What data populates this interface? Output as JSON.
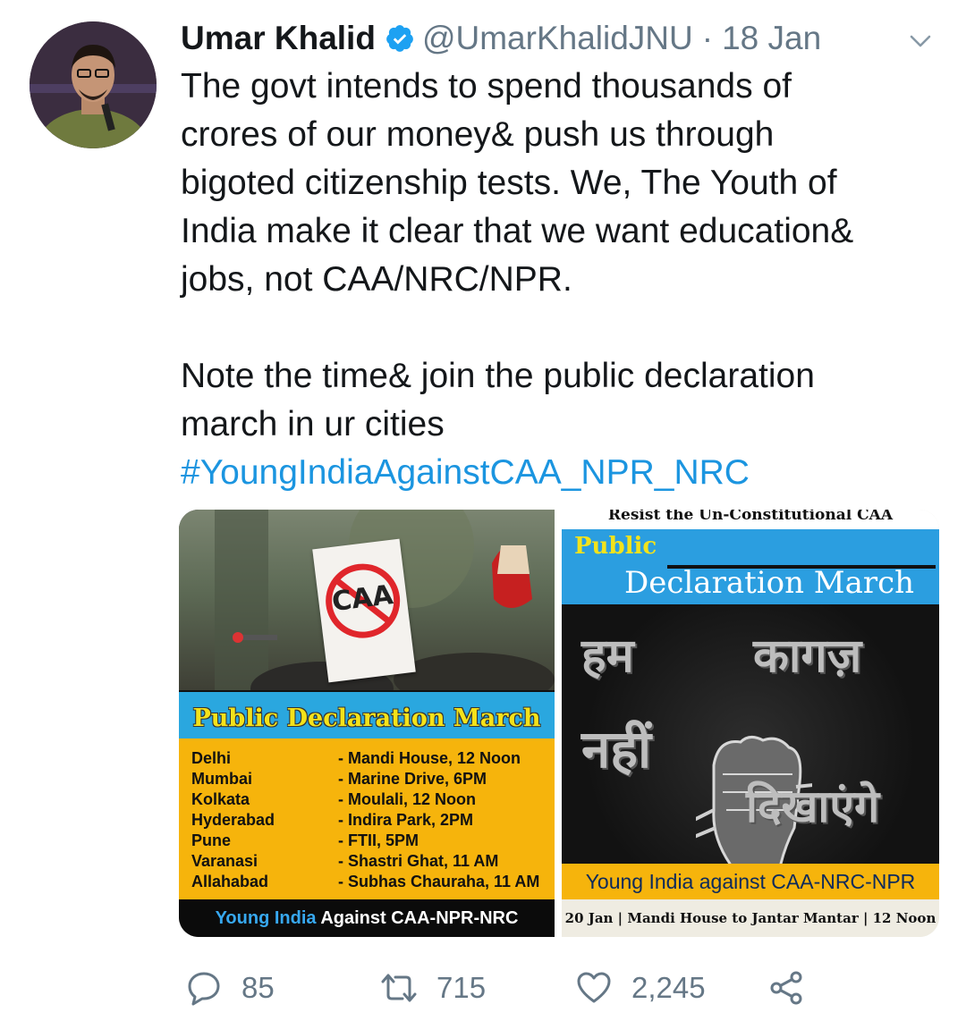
{
  "tweet": {
    "author_name": "Umar Khalid",
    "handle": "@UmarKhalidJNU",
    "separator": "·",
    "date": "18 Jan",
    "text_lines": [
      "The govt intends to spend thousands of",
      "crores of our money& push us through",
      "bigoted citizenship tests. We, The Youth of",
      "India make it clear that we want education&",
      "jobs, not CAA/NRC/NPR.",
      "Note the time& join the public declaration",
      "march in ur cities"
    ],
    "hashtag": "#YoungIndiaAgainstCAA_NPR_NRC"
  },
  "media_left": {
    "sign_text": "CAA",
    "title": "Public Declaration March",
    "rows": [
      {
        "city": "Delhi",
        "venue": "- Mandi House, 12 Noon"
      },
      {
        "city": "Mumbai",
        "venue": "- Marine Drive, 6PM"
      },
      {
        "city": "Kolkata",
        "venue": "- Moulali, 12 Noon"
      },
      {
        "city": "Hyderabad",
        "venue": "- Indira Park, 2PM"
      },
      {
        "city": "Pune",
        "venue": "- FTII, 5PM"
      },
      {
        "city": "Varanasi",
        "venue": "- Shastri Ghat, 11 AM"
      },
      {
        "city": "Allahabad",
        "venue": "- Subhas Chauraha, 11 AM"
      }
    ],
    "footer_blue": "Young India",
    "footer_white": " Against CAA-NPR-NRC"
  },
  "media_right": {
    "top_text": "Resist the Un-Constitutional CAA",
    "public": "Public",
    "declaration": "Declaration March",
    "hindi_1": "हम",
    "hindi_2": "कागज़",
    "hindi_3": "नहीं",
    "hindi_4": "दिखाएंगे",
    "yellow_text": "Young India against CAA-NRC-NPR",
    "bottom_text": "20 Jan | Mandi House to Jantar Mantar | 12 Noon"
  },
  "actions": {
    "replies": "85",
    "retweets": "715",
    "likes": "2,245"
  },
  "colors": {
    "link_blue": "#1b95e0",
    "secondary_gray": "#657786"
  }
}
